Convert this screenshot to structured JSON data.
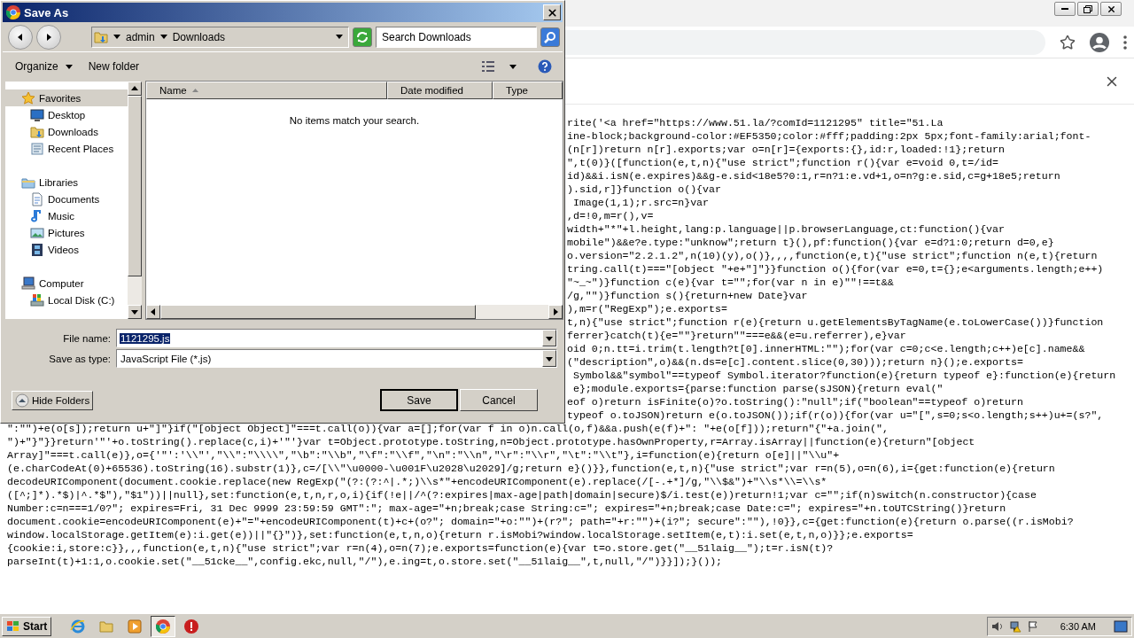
{
  "dialog": {
    "title": "Save As",
    "breadcrumb": [
      "admin",
      "Downloads"
    ],
    "search": {
      "placeholder": "Search Downloads"
    },
    "toolbar": [
      {
        "kind": "menu",
        "label": "Organize"
      },
      {
        "kind": "button",
        "label": "New folder"
      }
    ],
    "nav_tree": [
      {
        "kind": "favorites",
        "label": "Favorites",
        "selected": true,
        "children": [
          {
            "kind": "desktop",
            "label": "Desktop",
            "selected": false
          },
          {
            "kind": "downloads",
            "label": "Downloads",
            "selected": false
          },
          {
            "kind": "recent",
            "label": "Recent Places",
            "selected": false
          }
        ]
      },
      {
        "kind": "libraries",
        "label": "Libraries",
        "selected": false,
        "children": [
          {
            "kind": "documents",
            "label": "Documents",
            "selected": false
          },
          {
            "kind": "music",
            "label": "Music",
            "selected": false
          },
          {
            "kind": "pictures",
            "label": "Pictures",
            "selected": false
          },
          {
            "kind": "videos",
            "label": "Videos",
            "selected": false
          }
        ]
      },
      {
        "kind": "computer",
        "label": "Computer",
        "selected": false,
        "children": [
          {
            "kind": "disk",
            "label": "Local Disk (C:)",
            "selected": false
          }
        ]
      }
    ],
    "columns": [
      {
        "label": "Name",
        "sorted": true
      },
      {
        "label": "Date modified",
        "sorted": false
      },
      {
        "label": "Type",
        "sorted": false
      }
    ],
    "empty_message": "No items match your search.",
    "fields": [
      {
        "label": "File name:",
        "value": "1121295.js",
        "text_selected": true
      },
      {
        "label": "Save as type:",
        "value": "JavaScript File (*.js)",
        "text_selected": false
      }
    ],
    "hide_folders": "Hide Folders",
    "buttons": [
      {
        "label": "Save",
        "default": true
      },
      {
        "label": "Cancel",
        "default": false
      }
    ]
  },
  "browser": {
    "code_right_parts": [
      "rite('<a href=\"https://www.51.la/?comId=1121295\" title=\"51.La",
      "ine-block;background-color:#EF5350;color:#fff;padding:2px 5px;font-family:arial;font-",
      "(n[r])return n[r].exports;var o=n[r]={exports:{},id:r,loaded:!1};return",
      "\",t(0)}([function(e,t,n){\"use strict\";function r(){var e=void 0,t=/id=",
      "id)&&i.isN(e.expires)&&g-e.sid<18e5?0:1,r=n?1:e.vd+1,o=n?g:e.sid,c=g+18e5;return",
      ").sid,r]}function o(){var",
      " Image(1,1);r.src=n}var",
      ",d=!0,m=r(),v=",
      "width+\"*\"+l.height,lang:p.language||p.browserLanguage,ct:function(){var",
      "mobile\")&&e?e.type:\"unknow\";return t}(),pf:function(){var e=d?1:0;return d=0,e}",
      "o.version=\"2.2.1.2\",n(10)(y),o()},,,,function(e,t){\"use strict\";function n(e,t){return",
      "tring.call(t)===\"[object \"+e+\"]\"}}function o(){for(var e=0,t={};e<arguments.length;e++)",
      "\"~_~\")}function c(e){var t=\"\";for(var n in e)\"\"!==t&&",
      "/g,\"\")}function s(){return+new Date}var",
      "),m=r(\"RegExp\");e.exports=",
      "t,n){\"use strict\";function r(e){return u.getElementsByTagName(e.toLowerCase())}function",
      "ferrer}catch(t){e=\"\"}return\"\"===e&&(e=u.referrer),e}var",
      "oid 0;n.tt=i.trim(t.length?t[0].innerHTML:\"\");for(var c=0;c<e.length;c++)e[c].name&&",
      "(\"description\",o)&&(n.ds=e[c].content.slice(0,30)));return n}();e.exports=",
      " Symbol&&\"symbol\"==typeof Symbol.iterator?function(e){return typeof e}:function(e){return",
      " e};module.exports={parse:function parse(sJSON){return eval(\"",
      "eof o)return isFinite(o)?o.toString():\"null\";if(\"boolean\"==typeof o)return",
      "typeof o.toJSON)return e(o.toJSON());if(r(o)){for(var u=\"[\",s=0;s<o.length;s++)u+=(s?\","
    ],
    "code_lines": [
      "\":\"\")+e(o[s]);return u+\"]\"}if(\"[object Object]\"===t.call(o)){var a=[];for(var f in o)n.call(o,f)&&a.push(e(f)+\": \"+e(o[f]));return\"{\"+a.join(\",",
      "\")+\"}\"}}return'\"'+o.toString().replace(c,i)+'\"'}var t=Object.prototype.toString,n=Object.prototype.hasOwnProperty,r=Array.isArray||function(e){return\"[object",
      "Array]\"===t.call(e)},o={'\"':'\\\\\"',\"\\\\\":\"\\\\\\\\\",\"\\b\":\"\\\\b\",\"\\f\":\"\\\\f\",\"\\n\":\"\\\\n\",\"\\r\":\"\\\\r\",\"\\t\":\"\\\\t\"},i=function(e){return o[e]||\"\\\\u\"+",
      "(e.charCodeAt(0)+65536).toString(16).substr(1)},c=/[\\\\\"\\u0000-\\u001F\\u2028\\u2029]/g;return e}()}},function(e,t,n){\"use strict\";var r=n(5),o=n(6),i={get:function(e){return",
      "decodeURIComponent(document.cookie.replace(new RegExp(\"(?:(?:^|.*;)\\\\s*\"+encodeURIComponent(e).replace(/[-.+*]/g,\"\\\\$&\")+\"\\\\s*\\\\=\\\\s*",
      "([^;]*).*$)|^.*$\"),\"$1\"))||null},set:function(e,t,n,r,o,i){if(!e||/^(?:expires|max-age|path|domain|secure)$/i.test(e))return!1;var c=\"\";if(n)switch(n.constructor){case",
      "Number:c=n===1/0?\"; expires=Fri, 31 Dec 9999 23:59:59 GMT\":\"; max-age=\"+n;break;case String:c=\"; expires=\"+n;break;case Date:c=\"; expires=\"+n.toUTCString()}return",
      "document.cookie=encodeURIComponent(e)+\"=\"+encodeURIComponent(t)+c+(o?\"; domain=\"+o:\"\")+(r?\"; path=\"+r:\"\")+(i?\"; secure\":\"\"),!0}},c={get:function(e){return o.parse((r.isMobi?",
      "window.localStorage.getItem(e):i.get(e))||\"{}\")},set:function(e,t,n,o){return r.isMobi?window.localStorage.setItem(e,t):i.set(e,t,n,o)}};e.exports=",
      "{cookie:i,store:c}},,,function(e,t,n){\"use strict\";var r=n(4),o=n(7);e.exports=function(e){var t=o.store.get(\"__51laig__\");t=r.isN(t)?",
      "parseInt(t)+1:1,o.cookie.set(\"__51cke__\",config.ekc,null,\"/\"),e.ing=t,o.store.set(\"__51laig__\",t,null,\"/\")}}]);}());"
    ]
  },
  "taskbar": {
    "start": "Start",
    "apps": [
      {
        "kind": "ie",
        "active": false
      },
      {
        "kind": "explorer",
        "active": false
      },
      {
        "kind": "media",
        "active": false
      },
      {
        "kind": "chrome",
        "active": true
      },
      {
        "kind": "stop",
        "active": false
      }
    ],
    "clock": "6:30 AM"
  }
}
